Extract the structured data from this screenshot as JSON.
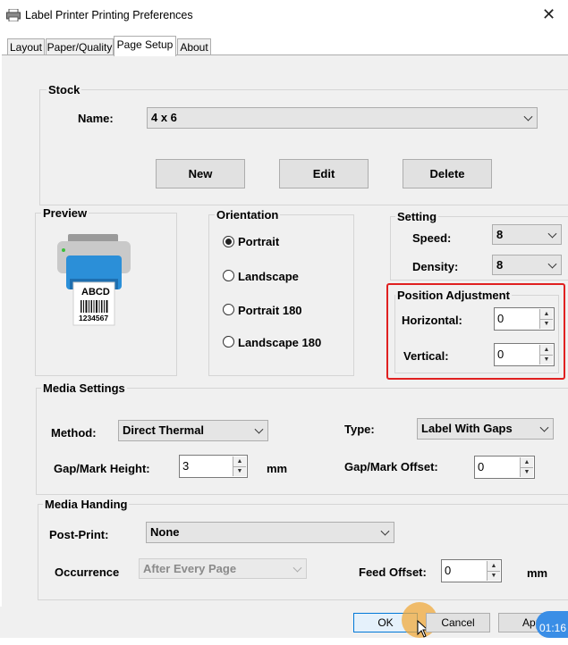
{
  "window": {
    "title": "Label Printer Printing Preferences",
    "close_glyph": "✕"
  },
  "tabs": [
    {
      "label": "Layout"
    },
    {
      "label": "Paper/Quality"
    },
    {
      "label": "Page Setup",
      "active": true
    },
    {
      "label": "About"
    }
  ],
  "stock": {
    "legend": "Stock",
    "name_label": "Name:",
    "name_value": "4 x 6",
    "new_button": "New",
    "edit_button": "Edit",
    "delete_button": "Delete"
  },
  "preview": {
    "legend": "Preview",
    "label_text": "ABCD",
    "barcode_number": "1234567"
  },
  "orientation": {
    "legend": "Orientation",
    "options": [
      "Portrait",
      "Landscape",
      "Portrait 180",
      "Landscape 180"
    ],
    "selected": "Portrait"
  },
  "setting": {
    "legend": "Setting",
    "speed_label": "Speed:",
    "speed_value": "8",
    "density_label": "Density:",
    "density_value": "8"
  },
  "position_adjustment": {
    "legend": "Position Adjustment",
    "horizontal_label": "Horizontal:",
    "horizontal_value": "0",
    "vertical_label": "Vertical:",
    "vertical_value": "0"
  },
  "media_settings": {
    "legend": "Media Settings",
    "method_label": "Method:",
    "method_value": "Direct Thermal",
    "type_label": "Type:",
    "type_value": "Label With Gaps",
    "gap_height_label": "Gap/Mark Height:",
    "gap_height_value": "3",
    "gap_height_unit": "mm",
    "gap_offset_label": "Gap/Mark Offset:",
    "gap_offset_value": "0"
  },
  "media_handling": {
    "legend": "Media Handing",
    "post_print_label": "Post-Print:",
    "post_print_value": "None",
    "occurrence_label": "Occurrence",
    "occurrence_value": "After Every Page",
    "feed_offset_label": "Feed Offset:",
    "feed_offset_value": "0",
    "feed_offset_unit": "mm"
  },
  "footer": {
    "ok_button": "OK",
    "cancel_button": "Cancel",
    "apply_button": "App",
    "clock_text": "01:16"
  },
  "colors": {
    "highlight": "#e02020",
    "printer_blue": "#2b8fd8",
    "clock_blue": "#3a8ee6"
  }
}
